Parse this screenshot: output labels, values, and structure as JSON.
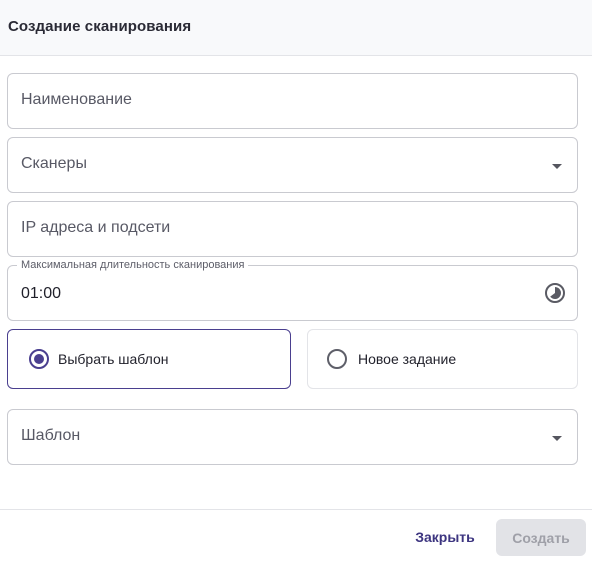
{
  "dialog": {
    "title": "Создание сканирования"
  },
  "fields": {
    "name": {
      "placeholder": "Наименование"
    },
    "scanners": {
      "placeholder": "Сканеры",
      "icon": "chevron-down-icon"
    },
    "ip": {
      "placeholder": "IP адреса и подсети"
    },
    "duration": {
      "label": "Максимальная длительность сканирования",
      "value": "01:00",
      "icon": "clock-icon"
    },
    "template": {
      "placeholder": "Шаблон",
      "icon": "chevron-down-icon"
    }
  },
  "mode": {
    "options": [
      {
        "label": "Выбрать шаблон",
        "selected": true
      },
      {
        "label": "Новое задание",
        "selected": false
      }
    ]
  },
  "footer": {
    "close_label": "Закрыть",
    "create_label": "Создать",
    "create_disabled": true
  },
  "colors": {
    "accent": "#4a3f8f",
    "border": "#c9cad0",
    "header_bg": "#f8f9fb",
    "disabled_bg": "#e2e3e7"
  }
}
